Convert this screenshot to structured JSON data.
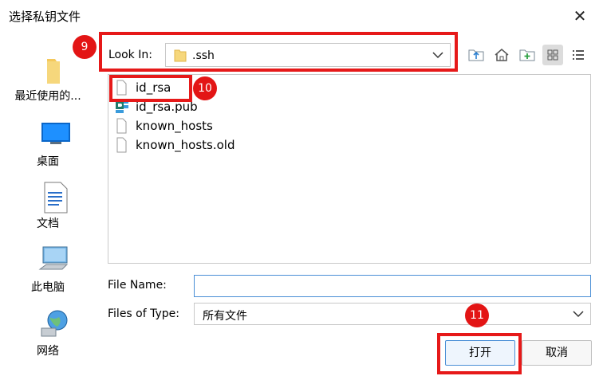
{
  "dialog": {
    "title": "选择私钥文件",
    "close_glyph": "✕"
  },
  "sidebar": {
    "items": [
      {
        "label": "最近使用的...",
        "icon": "folder-icon"
      },
      {
        "label": "桌面",
        "icon": "desktop-icon"
      },
      {
        "label": "文档",
        "icon": "document-icon"
      },
      {
        "label": "此电脑",
        "icon": "computer-icon"
      },
      {
        "label": "网络",
        "icon": "network-icon"
      }
    ]
  },
  "look_in": {
    "label": "Look In:",
    "value": ".ssh"
  },
  "toolbar": {
    "icons": [
      "up-folder-icon",
      "home-icon",
      "new-folder-icon",
      "grid-view-icon",
      "list-view-icon"
    ],
    "active": "grid-view-icon"
  },
  "files": [
    {
      "name": "id_rsa",
      "icon": "file-icon"
    },
    {
      "name": "id_rsa.pub",
      "icon": "pub-file-icon"
    },
    {
      "name": "known_hosts",
      "icon": "file-icon"
    },
    {
      "name": "known_hosts.old",
      "icon": "file-icon"
    }
  ],
  "file_name": {
    "label": "File Name:",
    "value": ""
  },
  "file_type": {
    "label": "Files of Type:",
    "value": "所有文件"
  },
  "buttons": {
    "open": "打开",
    "cancel": "取消"
  },
  "annotations": {
    "badge_9": "9",
    "badge_10": "10",
    "badge_11": "11"
  },
  "colors": {
    "annotation_red": "#e31515",
    "accent_blue": "#4a8fd6"
  }
}
